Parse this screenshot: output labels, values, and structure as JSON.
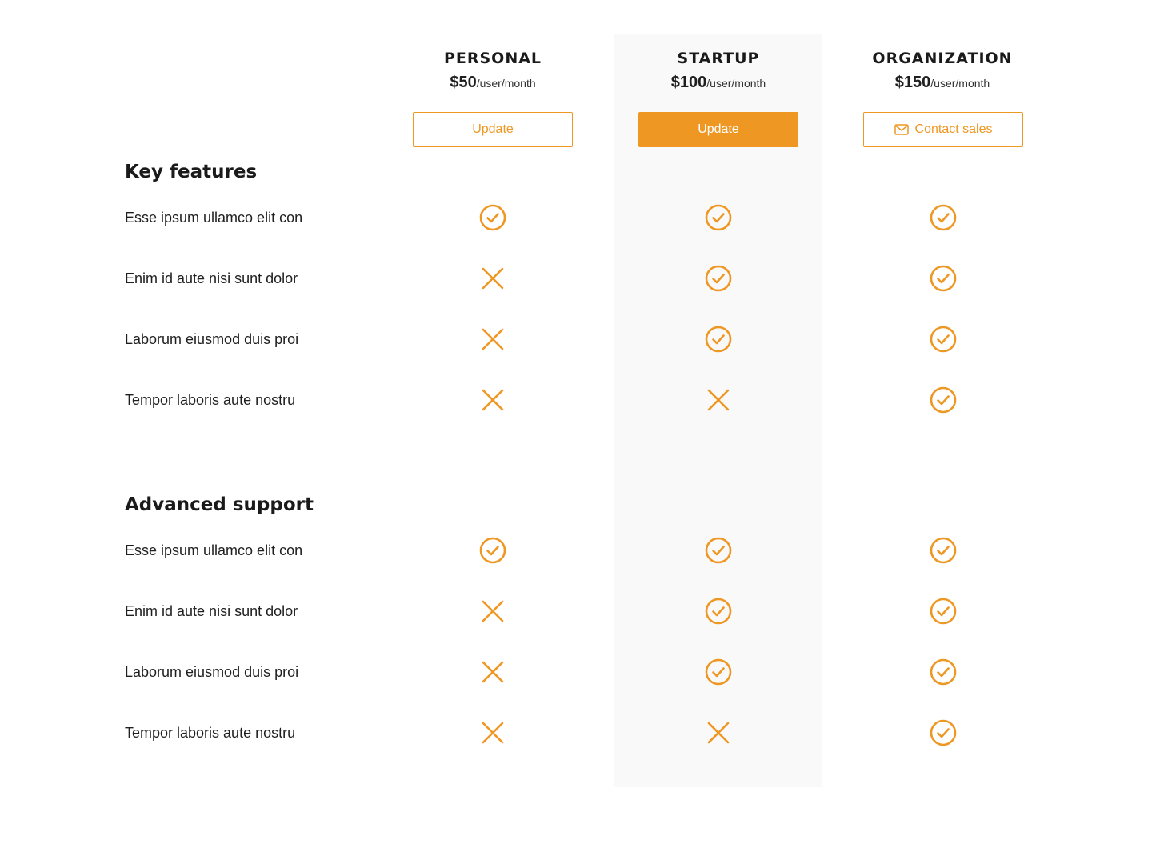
{
  "colors": {
    "accent": "#ee9722",
    "highlight_bg": "#f9f9f9",
    "text": "#1a1a1a"
  },
  "plans": [
    {
      "name": "PERSONAL",
      "price": "$50",
      "unit": "/user/month",
      "button": "Update",
      "button_style": "outline"
    },
    {
      "name": "STARTUP",
      "price": "$100",
      "unit": "/user/month",
      "button": "Update",
      "button_style": "filled"
    },
    {
      "name": "ORGANIZATION",
      "price": "$150",
      "unit": "/user/month",
      "button": "Contact sales",
      "button_style": "outline",
      "button_icon": "mail-icon"
    }
  ],
  "sections": [
    {
      "title": "Key features",
      "features": [
        {
          "label": "Esse ipsum ullamco elit con",
          "availability": [
            "check",
            "check",
            "check"
          ]
        },
        {
          "label": "Enim id aute nisi sunt dolor",
          "availability": [
            "cross",
            "check",
            "check"
          ]
        },
        {
          "label": "Laborum eiusmod duis proi",
          "availability": [
            "cross",
            "check",
            "check"
          ]
        },
        {
          "label": "Tempor laboris aute nostru",
          "availability": [
            "cross",
            "cross",
            "check"
          ]
        }
      ]
    },
    {
      "title": "Advanced support",
      "features": [
        {
          "label": "Esse ipsum ullamco elit con",
          "availability": [
            "check",
            "check",
            "check"
          ]
        },
        {
          "label": "Enim id aute nisi sunt dolor",
          "availability": [
            "cross",
            "check",
            "check"
          ]
        },
        {
          "label": "Laborum eiusmod duis proi",
          "availability": [
            "cross",
            "check",
            "check"
          ]
        },
        {
          "label": "Tempor laboris aute nostru",
          "availability": [
            "cross",
            "cross",
            "check"
          ]
        }
      ]
    }
  ]
}
